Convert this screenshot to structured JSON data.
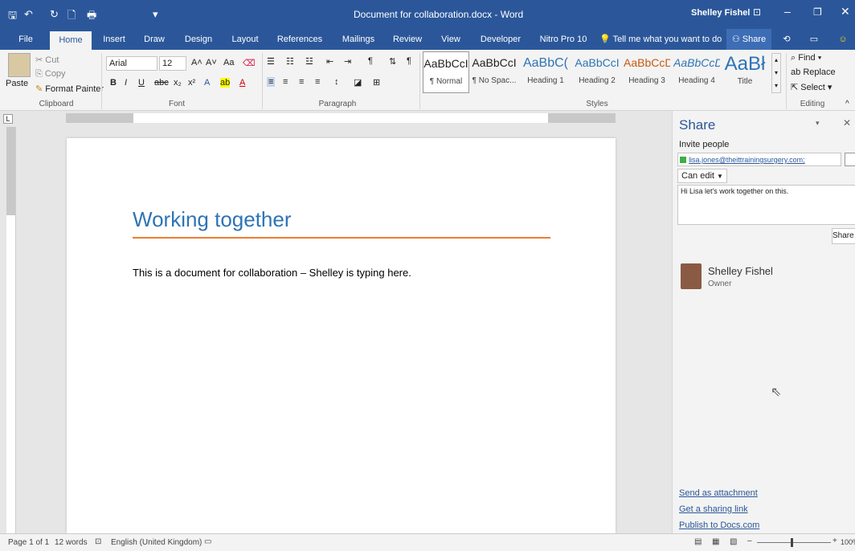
{
  "window": {
    "title": "Document for collaboration.docx - Word",
    "user": "Shelley Fishel"
  },
  "qat": {
    "save": "🖫",
    "undo": "↶",
    "redo": "↻",
    "new": "🗋",
    "print": "🖶",
    "more": "▾"
  },
  "tabs": [
    "File",
    "Home",
    "Insert",
    "Draw",
    "Design",
    "Layout",
    "References",
    "Mailings",
    "Review",
    "View",
    "Developer",
    "Nitro Pro 10"
  ],
  "tell_me": "Tell me what you want to do",
  "share_btn": "Share",
  "clipboard": {
    "paste": "Paste",
    "cut": "Cut",
    "copy": "Copy",
    "format_painter": "Format Painter",
    "label": "Clipboard"
  },
  "font": {
    "name": "Arial",
    "size": "12",
    "label": "Font"
  },
  "paragraph": {
    "label": "Paragraph"
  },
  "styles": {
    "label": "Styles",
    "items": [
      {
        "sample": "AaBbCcI",
        "name": "¶ Normal",
        "color": "#000"
      },
      {
        "sample": "AaBbCcI",
        "name": "¶ No Spac...",
        "color": "#000"
      },
      {
        "sample": "AaBbC(",
        "name": "Heading 1",
        "color": "#2e74b5"
      },
      {
        "sample": "AaBbCcI",
        "name": "Heading 2",
        "color": "#2e74b5"
      },
      {
        "sample": "AaBbCcD",
        "name": "Heading 3",
        "color": "#c55a11"
      },
      {
        "sample": "AaBbCcD(",
        "name": "Heading 4",
        "color": "#2e74b5"
      },
      {
        "sample": "AaBł",
        "name": "Title",
        "color": "#2e74b5"
      }
    ]
  },
  "editing": {
    "find": "Find",
    "replace": "Replace",
    "select": "Select",
    "label": "Editing"
  },
  "document": {
    "title": "Working together",
    "body": "This is a document for collaboration – Shelley is typing here."
  },
  "share_pane": {
    "title": "Share",
    "invite_label": "Invite people",
    "invite_value": "lisa.jones@theittrainingsurgery.com;",
    "permission": "Can edit",
    "message": "Hi Lisa let's work together on this.",
    "share_button": "Share",
    "owner_name": "Shelley Fishel",
    "owner_role": "Owner",
    "links": [
      "Send as attachment",
      "Get a sharing link",
      "Publish to Docs.com"
    ]
  },
  "status": {
    "page": "Page 1 of 1",
    "words": "12 words",
    "language": "English (United Kingdom)",
    "zoom": "100%"
  }
}
